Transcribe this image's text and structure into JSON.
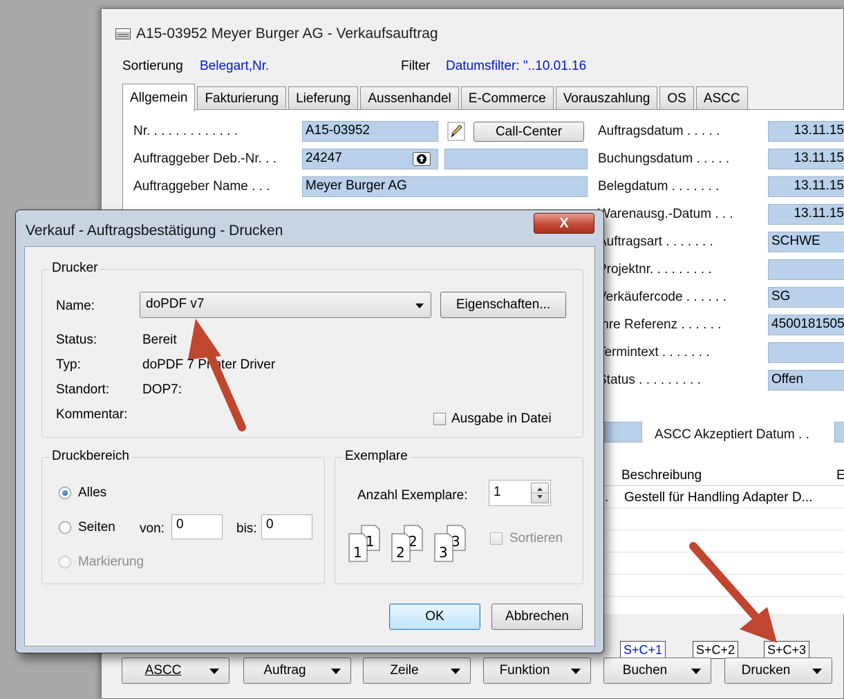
{
  "window": {
    "title": "A15-03952 Meyer Burger AG - Verkaufsauftrag",
    "sort_label": "Sortierung",
    "sort_value": "Belegart,Nr.",
    "filter_label": "Filter",
    "filter_value": "Datumsfilter: \"..10.01.16"
  },
  "tabs": [
    "Allgemein",
    "Fakturierung",
    "Lieferung",
    "Aussenhandel",
    "E-Commerce",
    "Vorauszahlung",
    "OS",
    "ASCC"
  ],
  "left_fields": {
    "nr_label": "Nr. . . . . . . . . . . . .",
    "nr_value": "A15-03952",
    "callcenter": "Call-Center",
    "deb_label": "Auftraggeber Deb.-Nr. . .",
    "deb_value": "24247",
    "name_label": "Auftraggeber Name . . .",
    "name_value": "Meyer Burger AG"
  },
  "right_fields": [
    {
      "label": "Auftragsdatum . . . . .",
      "value": "13.11.15"
    },
    {
      "label": "Buchungsdatum . . . . .",
      "value": "13.11.15"
    },
    {
      "label": "Belegdatum . . . . . . .",
      "value": "13.11.15"
    },
    {
      "label": "Warenausg.-Datum . . .",
      "value": "13.11.15"
    },
    {
      "label": "Auftragsart . . . . . . .",
      "value": "SCHWE"
    },
    {
      "label": "Projektnr. . . . . . . . .",
      "value": ""
    },
    {
      "label": "Verkäufercode . . . . . .",
      "value": "SG"
    },
    {
      "label": "Ihre Referenz . . . . . .",
      "value": "4500181505"
    },
    {
      "label": "Termintext . . . . . . .",
      "value": ""
    },
    {
      "label": "Status . . . . . . . . .",
      "value": "Offen"
    }
  ],
  "ascc_label": "ASCC Akzeptiert Datum . .",
  "grid": {
    "header": "Beschreibung",
    "header2": "E",
    "row1_prefix": ".",
    "row1": "Gestell für Handling Adapter D..."
  },
  "shortcuts": [
    "S+C+1",
    "S+C+2",
    "S+C+3"
  ],
  "bottom_buttons": [
    "ASCC",
    "Auftrag",
    "Zeile",
    "Funktion",
    "Buchen",
    "Drucken"
  ],
  "dialog": {
    "title": "Verkauf - Auftragsbestätigung - Drucken",
    "close": "X",
    "printer_group": "Drucker",
    "name_label": "Name:",
    "printer_name": "doPDF v7",
    "properties_button": "Eigenschaften...",
    "status_label": "Status:",
    "status_value": "Bereit",
    "type_label": "Typ:",
    "type_value": "doPDF 7 Printer Driver",
    "location_label": "Standort:",
    "location_value": "DOP7:",
    "comment_label": "Kommentar:",
    "print_to_file": "Ausgabe in Datei",
    "range_group": "Druckbereich",
    "all": "Alles",
    "pages": "Seiten",
    "from_label": "von:",
    "from_value": "0",
    "to_label": "bis:",
    "to_value": "0",
    "selection": "Markierung",
    "copies_group": "Exemplare",
    "copies_label": "Anzahl Exemplare:",
    "copies_value": "1",
    "collate": "Sortieren",
    "ok": "OK",
    "cancel": "Abbrechen"
  },
  "colors": {
    "field_blue": "#b9d1ea",
    "link_blue": "#0019c8",
    "arrow_red": "#c0462f"
  }
}
